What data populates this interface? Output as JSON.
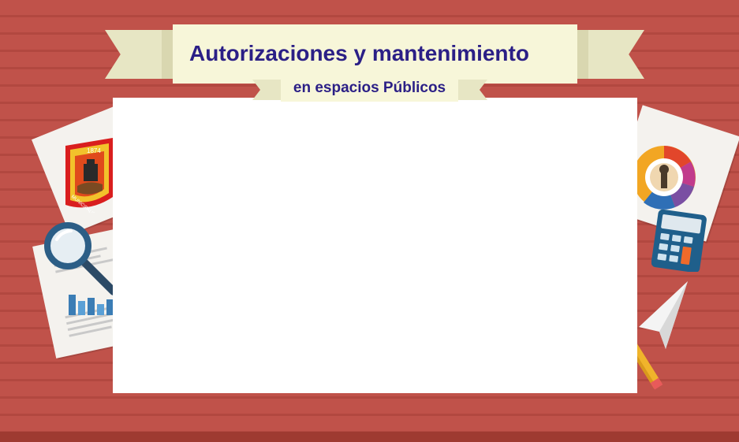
{
  "banner": {
    "title": "Autorizaciones y mantenimiento",
    "subtitle": "en espacios Públicos"
  },
  "seal": {
    "year": "1874",
    "text": "MUNICIPALIDAD"
  },
  "icons": {
    "seal": "municipal-seal-icon",
    "magnifier": "magnifying-glass-icon",
    "calculator": "calculator-icon",
    "chart_wheel": "category-wheel-icon",
    "paper_plane": "paper-plane-icon",
    "pencil": "pencil-icon"
  },
  "colors": {
    "desk": "#c0524a",
    "title_text": "#2b1f86",
    "ribbon": "#f7f6d9",
    "board": "#ffffff"
  }
}
